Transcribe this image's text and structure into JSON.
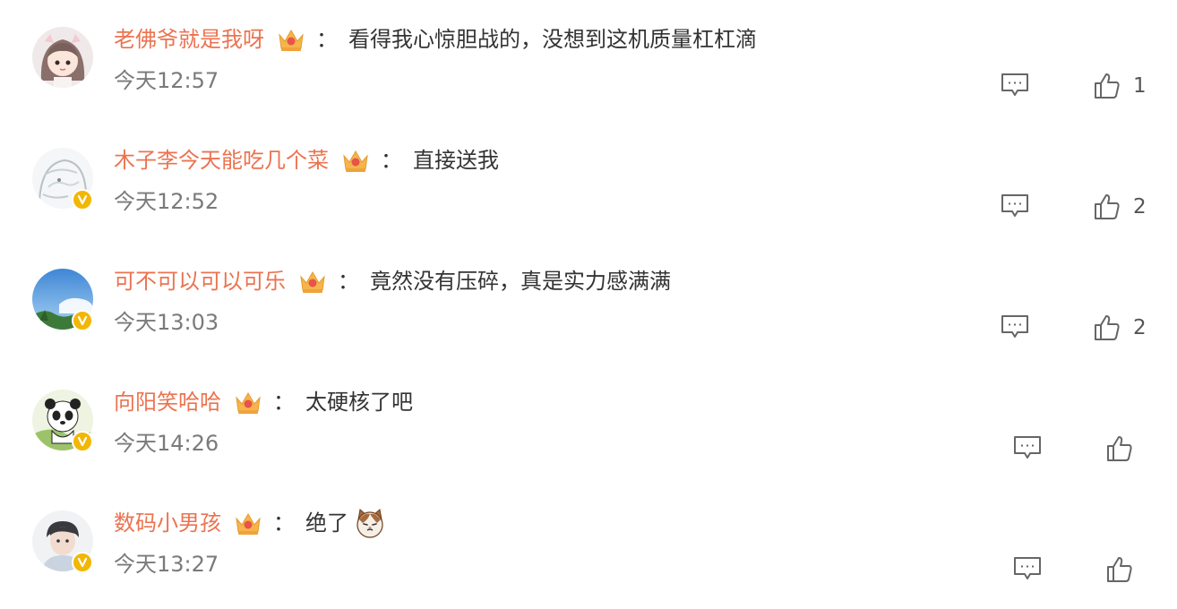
{
  "comments": [
    {
      "username": "老佛爷就是我呀",
      "colon": "：",
      "text": "看得我心惊胆战的，没想到这机质量杠杠滴",
      "time": "今天12:57",
      "likes": "1",
      "verified": false,
      "avatar_icon": "girl-avatar-icon"
    },
    {
      "username": "木子李今天能吃几个菜",
      "colon": "：",
      "text": "直接送我",
      "time": "今天12:52",
      "likes": "2",
      "verified": true,
      "avatar_icon": "anime-sketch-avatar-icon"
    },
    {
      "username": "可不可以可以可乐",
      "colon": "：",
      "text": "竟然没有压碎，真是实力感满满",
      "time": "今天13:03",
      "likes": "2",
      "verified": true,
      "avatar_icon": "sky-avatar-icon"
    },
    {
      "username": "向阳笑哈哈",
      "colon": "：",
      "text": "太硬核了吧",
      "time": "今天14:26",
      "likes": "",
      "verified": true,
      "avatar_icon": "panda-avatar-icon"
    },
    {
      "username": "数码小男孩",
      "colon": "：",
      "text": "绝了",
      "time": "今天13:27",
      "likes": "",
      "verified": true,
      "emoji_icon": "cat-emoji-icon",
      "avatar_icon": "boy-avatar-icon"
    }
  ],
  "colors": {
    "username": "#eb7350",
    "time": "#7a7a7a",
    "text": "#333333",
    "verified_badge": "#f2b705",
    "icon_stroke": "#666666"
  }
}
